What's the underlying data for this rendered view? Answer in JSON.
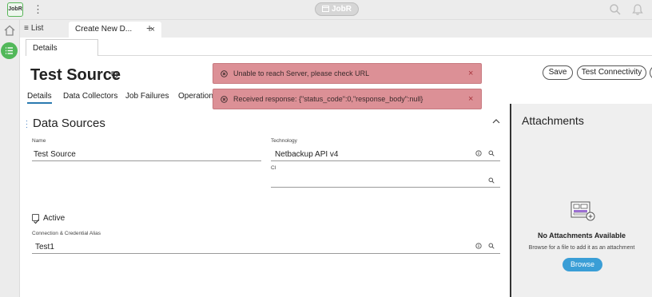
{
  "app": {
    "logo_text": "JobR",
    "center_title": "JobR"
  },
  "tabs": {
    "list_label": "List",
    "create_label": "Create New D...",
    "close_glyph": "×",
    "add_glyph": "+"
  },
  "record": {
    "subtab_label": "Details",
    "title": "Test Source",
    "buttons": {
      "save": "Save",
      "test": "Test Connectivity"
    },
    "tabs": [
      "Details",
      "Data Collectors",
      "Job Failures",
      "Operation I"
    ]
  },
  "form": {
    "section_title": "Data Sources",
    "name": {
      "label": "Name",
      "value": "Test Source"
    },
    "technology": {
      "label": "Technology",
      "value": "Netbackup API v4"
    },
    "ci": {
      "label": "CI",
      "value": ""
    },
    "active": {
      "label": "Active",
      "checked": true
    },
    "alias": {
      "label": "Connection & Credential Alias",
      "value": "Test1"
    }
  },
  "attachments": {
    "title": "Attachments",
    "empty_title": "No Attachments Available",
    "empty_hint": "Browse for a file to add it as an attachment",
    "browse_label": "Browse"
  },
  "toasts": [
    {
      "message": "Unable to reach Server, please check URL",
      "close_glyph": "×"
    },
    {
      "message": "Received response: {\"status_code\":0,\"response_body\":null}",
      "close_glyph": "×"
    }
  ],
  "colors": {
    "accent_green": "#52b85a",
    "error_toast": "#dc9096",
    "browse_blue": "#3a9ed6",
    "tab_underline": "#2a7ab0"
  }
}
